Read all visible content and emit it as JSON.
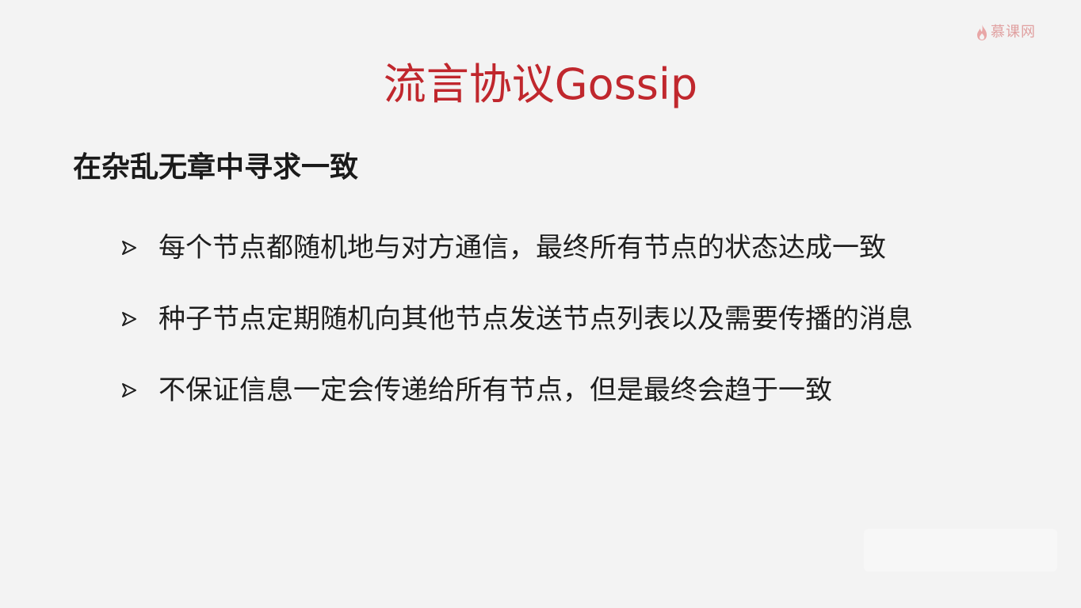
{
  "logo": {
    "text": "慕课网",
    "icon": "flame-icon",
    "color": "#e0a0a0"
  },
  "slide": {
    "title": "流言协议Gossip",
    "subtitle": "在杂乱无章中寻求一致",
    "bullets": [
      "每个节点都随机地与对方通信，最终所有节点的状态达成一致",
      "种子节点定期随机向其他节点发送节点列表以及需要传播的消息",
      "不保证信息一定会传递给所有节点，但是最终会趋于一致"
    ],
    "bullet_icon": "arrowhead-bullet-icon"
  },
  "colors": {
    "title": "#c0272d",
    "text": "#1a1a1a",
    "background": "#f3f3f3"
  }
}
